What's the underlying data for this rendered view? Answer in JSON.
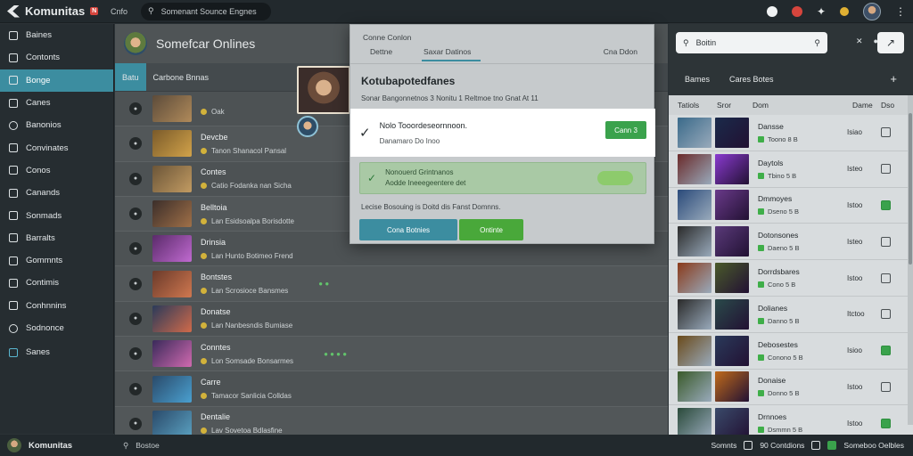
{
  "app": {
    "name": "Komunitas",
    "badge": "N",
    "top_link": "Cnfo",
    "search_placeholder": "Somenant Sounce Engnes"
  },
  "sidebar": {
    "items": [
      {
        "label": "Baines"
      },
      {
        "label": "Contonts"
      },
      {
        "label": "Bonge"
      },
      {
        "label": "Canes"
      },
      {
        "label": "Banonios"
      },
      {
        "label": "Convinates"
      },
      {
        "label": "Conos"
      },
      {
        "label": "Canands"
      },
      {
        "label": "Sonmads"
      },
      {
        "label": "Barralts"
      },
      {
        "label": "Gommnts"
      },
      {
        "label": "Contimis"
      },
      {
        "label": "Conhnnins"
      },
      {
        "label": "Sodnonce"
      },
      {
        "label": "Sanes"
      }
    ],
    "active_index": 2
  },
  "channel": {
    "title": "Somefcar Onlines",
    "tabs": [
      "Batu",
      "Carbone Bnnas"
    ]
  },
  "rows": [
    {
      "title": "",
      "sub": "Oak",
      "badges": "",
      "colors": [
        "#5c4b3a",
        "#b08a5a"
      ]
    },
    {
      "title": "Devcbe",
      "sub": "Tanon Shanacol Pansal",
      "badges": "",
      "colors": [
        "#7a5a2a",
        "#d2a34a"
      ]
    },
    {
      "title": "Contes",
      "sub": "Catio Fodanka nan Sicha",
      "badges": "",
      "colors": [
        "#6b5538",
        "#c29b62"
      ]
    },
    {
      "title": "Belltoia",
      "sub": "Lan Esidsoalpa Borisdotte",
      "badges": "",
      "colors": [
        "#3b2e2a",
        "#a07048"
      ]
    },
    {
      "title": "Drinsia",
      "sub": "Lan Hunto Botimeo Frend",
      "badges": "",
      "colors": [
        "#5a2a6a",
        "#c06ad0"
      ]
    },
    {
      "title": "Bontstes",
      "sub": "Lan Scrosioce Bansmes",
      "badges": "● ●",
      "colors": [
        "#6a3a2a",
        "#d07850"
      ]
    },
    {
      "title": "Donatse",
      "sub": "Lan Nanbesndis Bumiase",
      "badges": "",
      "colors": [
        "#2a3a5a",
        "#d06a4a"
      ]
    },
    {
      "title": "Conntes",
      "sub": "Lon Somsade Bonsarmes",
      "badges": "● ● ● ●",
      "colors": [
        "#3a2a5a",
        "#d06ab0"
      ]
    },
    {
      "title": "Carre",
      "sub": "Tamacor Sanlicia Colldas",
      "badges": "",
      "colors": [
        "#2a4a6a",
        "#4aa0d0"
      ]
    },
    {
      "title": "Dentalie",
      "sub": "Lav Sovetoa Bdlasfine",
      "badges": "",
      "colors": [
        "#2a4a6a",
        "#5aa0c0"
      ]
    }
  ],
  "modal": {
    "subtitle": "Conne Conlon",
    "tabs": [
      "Dettne",
      "Saxar Datinos",
      "Cna Ddon"
    ],
    "heading": "Kotubapotedfanes",
    "description": "Sonar Bangonnetnos 3 Nonitu 1 Reltmoe tno Gnat At 11",
    "notice_title": "Nolo Tooordeseornnoon.",
    "notice_sub": "Danamaro Do Inoo",
    "notice_button": "Cann 3",
    "alert_line1": "Nonouerd Grintnanos",
    "alert_line2": "Aodde Ineeegeentere det",
    "footer_text": "Lecise Bosouing is Doitd dis Fanst Domnns.",
    "btn_primary": "Cona Botnies",
    "btn_secondary": "Ontinte"
  },
  "right": {
    "search_placeholder": "Boitin",
    "tabs": [
      "Bames",
      "Cares Botes"
    ],
    "headers": [
      "Tatiols",
      "Sror",
      "Dom",
      "Dame",
      "Dso"
    ],
    "rows": [
      {
        "title": "Dansse",
        "sub": "Toono 8 B",
        "val": "Isiao",
        "checked": false,
        "colors": [
          "#3a6a8a",
          "#1a2a4a"
        ]
      },
      {
        "title": "Daytols",
        "sub": "Tbino 5 B",
        "val": "Isteo",
        "checked": false,
        "colors": [
          "#6a2a2a",
          "#8a3ad0"
        ]
      },
      {
        "title": "Dmmoyes",
        "sub": "Dseno 5 B",
        "val": "Istoo",
        "checked": true,
        "colors": [
          "#2a4a7a",
          "#6a3a8a"
        ]
      },
      {
        "title": "Dotonsones",
        "sub": "Daeno 5 B",
        "val": "Isteo",
        "checked": false,
        "colors": [
          "#2a2a2a",
          "#5a3a7a"
        ]
      },
      {
        "title": "Dorrdsbares",
        "sub": "Cono 5 B",
        "val": "Istoo",
        "checked": false,
        "colors": [
          "#8a3a1a",
          "#4a5a2a"
        ]
      },
      {
        "title": "Dolianes",
        "sub": "Danno 5 B",
        "val": "Itctoo",
        "checked": false,
        "colors": [
          "#2a2a2a",
          "#2a4a4a"
        ]
      },
      {
        "title": "Debosestes",
        "sub": "Conono 5 B",
        "val": "Isioo",
        "checked": true,
        "colors": [
          "#6a4a1a",
          "#2a3a5a"
        ]
      },
      {
        "title": "Donaise",
        "sub": "Donno 5 B",
        "val": "Istoo",
        "checked": false,
        "colors": [
          "#3a5a2a",
          "#c06a1a"
        ]
      },
      {
        "title": "Drnnoes",
        "sub": "Dsmmn 5 B",
        "val": "Istoo",
        "checked": true,
        "colors": [
          "#2a4a3a",
          "#3a4a6a"
        ]
      }
    ]
  },
  "bottom": {
    "name": "Komunitas",
    "search": "Bostoe",
    "right_items": [
      "Somnts",
      "90 Contdions",
      "Someboo Oelbles"
    ]
  }
}
